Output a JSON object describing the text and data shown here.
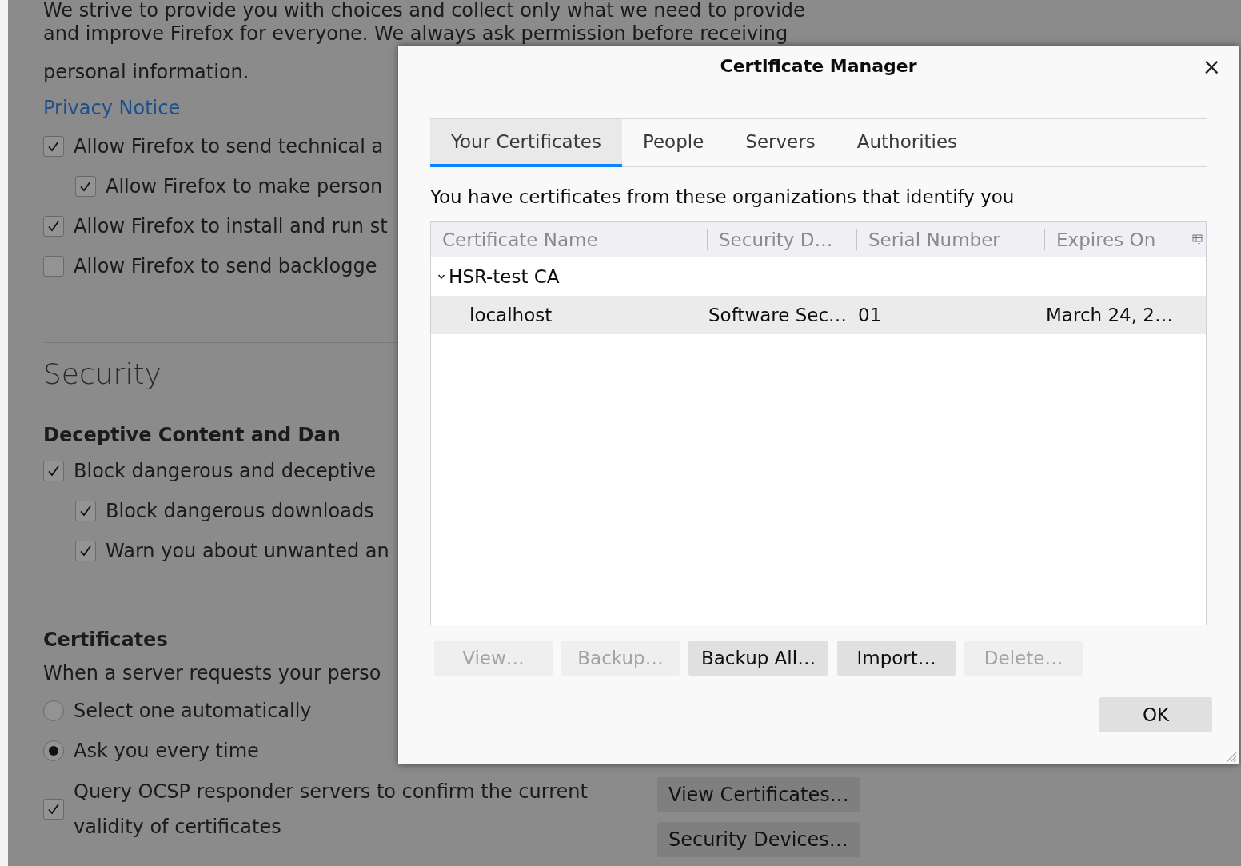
{
  "page": {
    "intro_lines": [
      "We strive to provide you with choices and collect only what we need to provide",
      "and improve Firefox for everyone. We always ask permission before receiving",
      "personal information."
    ],
    "privacy_link": "Privacy Notice",
    "data_options": [
      {
        "label": "Allow Firefox to send technical a",
        "checked": true,
        "nested": false
      },
      {
        "label": "Allow Firefox to make person",
        "checked": true,
        "nested": true
      },
      {
        "label": "Allow Firefox to install and run st",
        "checked": true,
        "nested": false
      },
      {
        "label": "Allow Firefox to send backlogge",
        "checked": false,
        "nested": false
      }
    ],
    "security_heading": "Security",
    "deceptive_heading": "Deceptive Content and Dan",
    "deceptive_options": [
      {
        "label": "Block dangerous and deceptive",
        "checked": true,
        "nested": false
      },
      {
        "label": "Block dangerous downloads",
        "checked": true,
        "nested": true
      },
      {
        "label": "Warn you about unwanted an",
        "checked": true,
        "nested": true
      }
    ],
    "certificates_heading": "Certificates",
    "certificates_text": "When a server requests your perso",
    "radios": [
      {
        "label": "Select one automatically",
        "selected": false
      },
      {
        "label": "Ask you every time",
        "selected": true
      }
    ],
    "ocsp": {
      "label": "Query OCSP responder servers to confirm the current validity of certificates",
      "checked": true
    },
    "buttons": [
      "View Certificates…",
      "Security Devices…"
    ]
  },
  "dialog": {
    "title": "Certificate Manager",
    "close": "×",
    "tabs": [
      {
        "label": "Your Certificates",
        "selected": true
      },
      {
        "label": "People",
        "selected": false
      },
      {
        "label": "Servers",
        "selected": false
      },
      {
        "label": "Authorities",
        "selected": false
      }
    ],
    "description": "You have certificates from these organizations that identify you",
    "columns": [
      "Certificate Name",
      "Security D…",
      "Serial Number",
      "Expires On"
    ],
    "rows": [
      {
        "kind": "group",
        "expanded": true,
        "selected": false,
        "cells": [
          "HSR-test CA"
        ]
      },
      {
        "kind": "item",
        "selected": true,
        "cells": [
          "localhost",
          "Software Sec…",
          "01",
          "March 24, 2…"
        ]
      }
    ],
    "actions": [
      {
        "label": "View…",
        "disabled": true
      },
      {
        "label": "Backup…",
        "disabled": true
      },
      {
        "label": "Backup All…",
        "disabled": false
      },
      {
        "label": "Import…",
        "disabled": false
      },
      {
        "label": "Delete…",
        "disabled": true
      }
    ],
    "ok": "OK"
  }
}
